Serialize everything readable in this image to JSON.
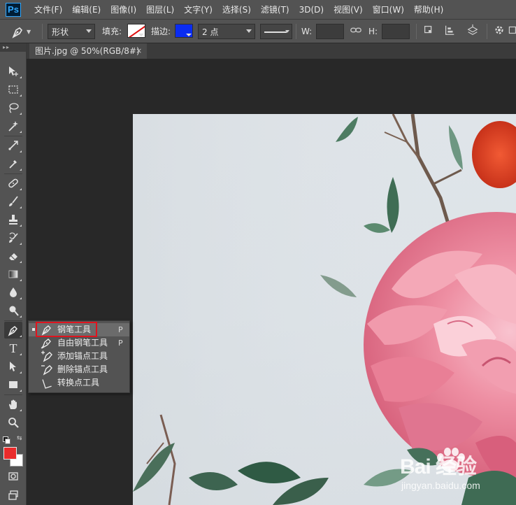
{
  "app": {
    "logo": "Ps"
  },
  "menu": [
    "文件(F)",
    "编辑(E)",
    "图像(I)",
    "图层(L)",
    "文字(Y)",
    "选择(S)",
    "滤镜(T)",
    "3D(D)",
    "视图(V)",
    "窗口(W)",
    "帮助(H)"
  ],
  "options": {
    "tool_mode": "形状",
    "fill_label": "填充:",
    "stroke_label": "描边:",
    "stroke_width": "2 点",
    "w_label": "W:",
    "h_label": "H:",
    "fill_color": "#ffffff",
    "stroke_color": "#0a2cf2"
  },
  "document_tab": {
    "title": "图片.jpg @ 50%(RGB/8#)",
    "close": "×"
  },
  "colors": {
    "foreground": "#ea2b2b",
    "background": "#ffffff"
  },
  "flyout": {
    "items": [
      {
        "label": "钢笔工具",
        "key": "P",
        "selected": true,
        "icon": "pen-icon"
      },
      {
        "label": "自由钢笔工具",
        "key": "P",
        "selected": false,
        "icon": "freeform-pen-icon"
      },
      {
        "label": "添加锚点工具",
        "key": "",
        "selected": false,
        "icon": "add-anchor-icon"
      },
      {
        "label": "删除锚点工具",
        "key": "",
        "selected": false,
        "icon": "delete-anchor-icon"
      },
      {
        "label": "转换点工具",
        "key": "",
        "selected": false,
        "icon": "convert-point-icon"
      }
    ]
  },
  "watermark": {
    "main": "Bai 经验",
    "sub": "jingyan.baidu.com"
  }
}
